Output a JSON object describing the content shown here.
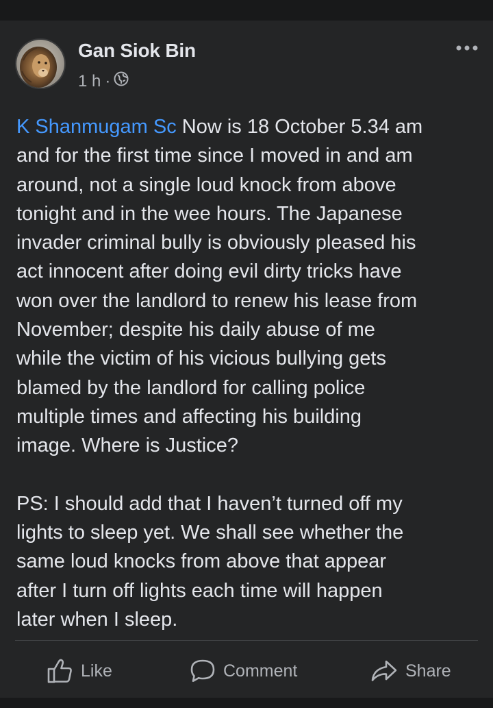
{
  "post": {
    "author": "Gan Siok Bin",
    "time": "1 h",
    "separator": "·",
    "audience_icon": "globe-icon",
    "more_icon": "more-dots-icon",
    "mention": "K Shanmugam Sc",
    "lines": [
      " Now is 18 October 5.34 am",
      "and for the first time since I moved in and am",
      "around, not a single loud knock from above",
      "tonight and in the wee hours. The Japanese",
      "invader criminal bully is obviously pleased his",
      "act innocent after doing evil dirty tricks have",
      "won over the landlord to renew his lease from",
      "November; despite his daily abuse of me",
      "while the victim of his vicious bullying gets",
      "blamed by the landlord for calling police",
      "multiple times and affecting his building",
      "image. Where is Justice?"
    ],
    "ps_lines": [
      "PS: I should add that I haven’t turned off my",
      "lights to sleep yet. We shall see whether the",
      "same loud knocks from above that appear",
      "after I turn off lights each time will happen",
      "later when I sleep."
    ]
  },
  "actions": {
    "like": "Like",
    "comment": "Comment",
    "share": "Share"
  },
  "colors": {
    "background": "#18191a",
    "card": "#242526",
    "text": "#e4e6eb",
    "secondary_text": "#b0b3b8",
    "mention": "#4599ff"
  }
}
